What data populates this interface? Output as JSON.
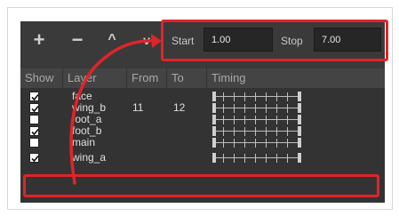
{
  "toolbar": {
    "add_icon": "+",
    "remove_icon": "−",
    "up_icon": "^",
    "down_icon": "v",
    "start_label": "Start",
    "start_value": "1.00",
    "stop_label": "Stop",
    "stop_value": "7.00"
  },
  "columns": {
    "show": "Show",
    "layer": "Layer",
    "from": "From",
    "to": "To",
    "timing": "Timing"
  },
  "rows": [
    {
      "layer": "face",
      "checked": true,
      "from": "",
      "to": ""
    },
    {
      "layer": "wing_b",
      "checked": true,
      "from": "11",
      "to": "12"
    },
    {
      "layer": "foot_a",
      "checked": false,
      "from": "",
      "to": ""
    },
    {
      "layer": "foot_b",
      "checked": true,
      "from": "",
      "to": ""
    },
    {
      "layer": "main",
      "checked": false,
      "from": "",
      "to": ""
    },
    {
      "layer": "wing_a",
      "checked": true,
      "from": "",
      "to": ""
    }
  ],
  "colors": {
    "highlight": "#e0242a",
    "panel_bg": "#3a3a3a"
  }
}
